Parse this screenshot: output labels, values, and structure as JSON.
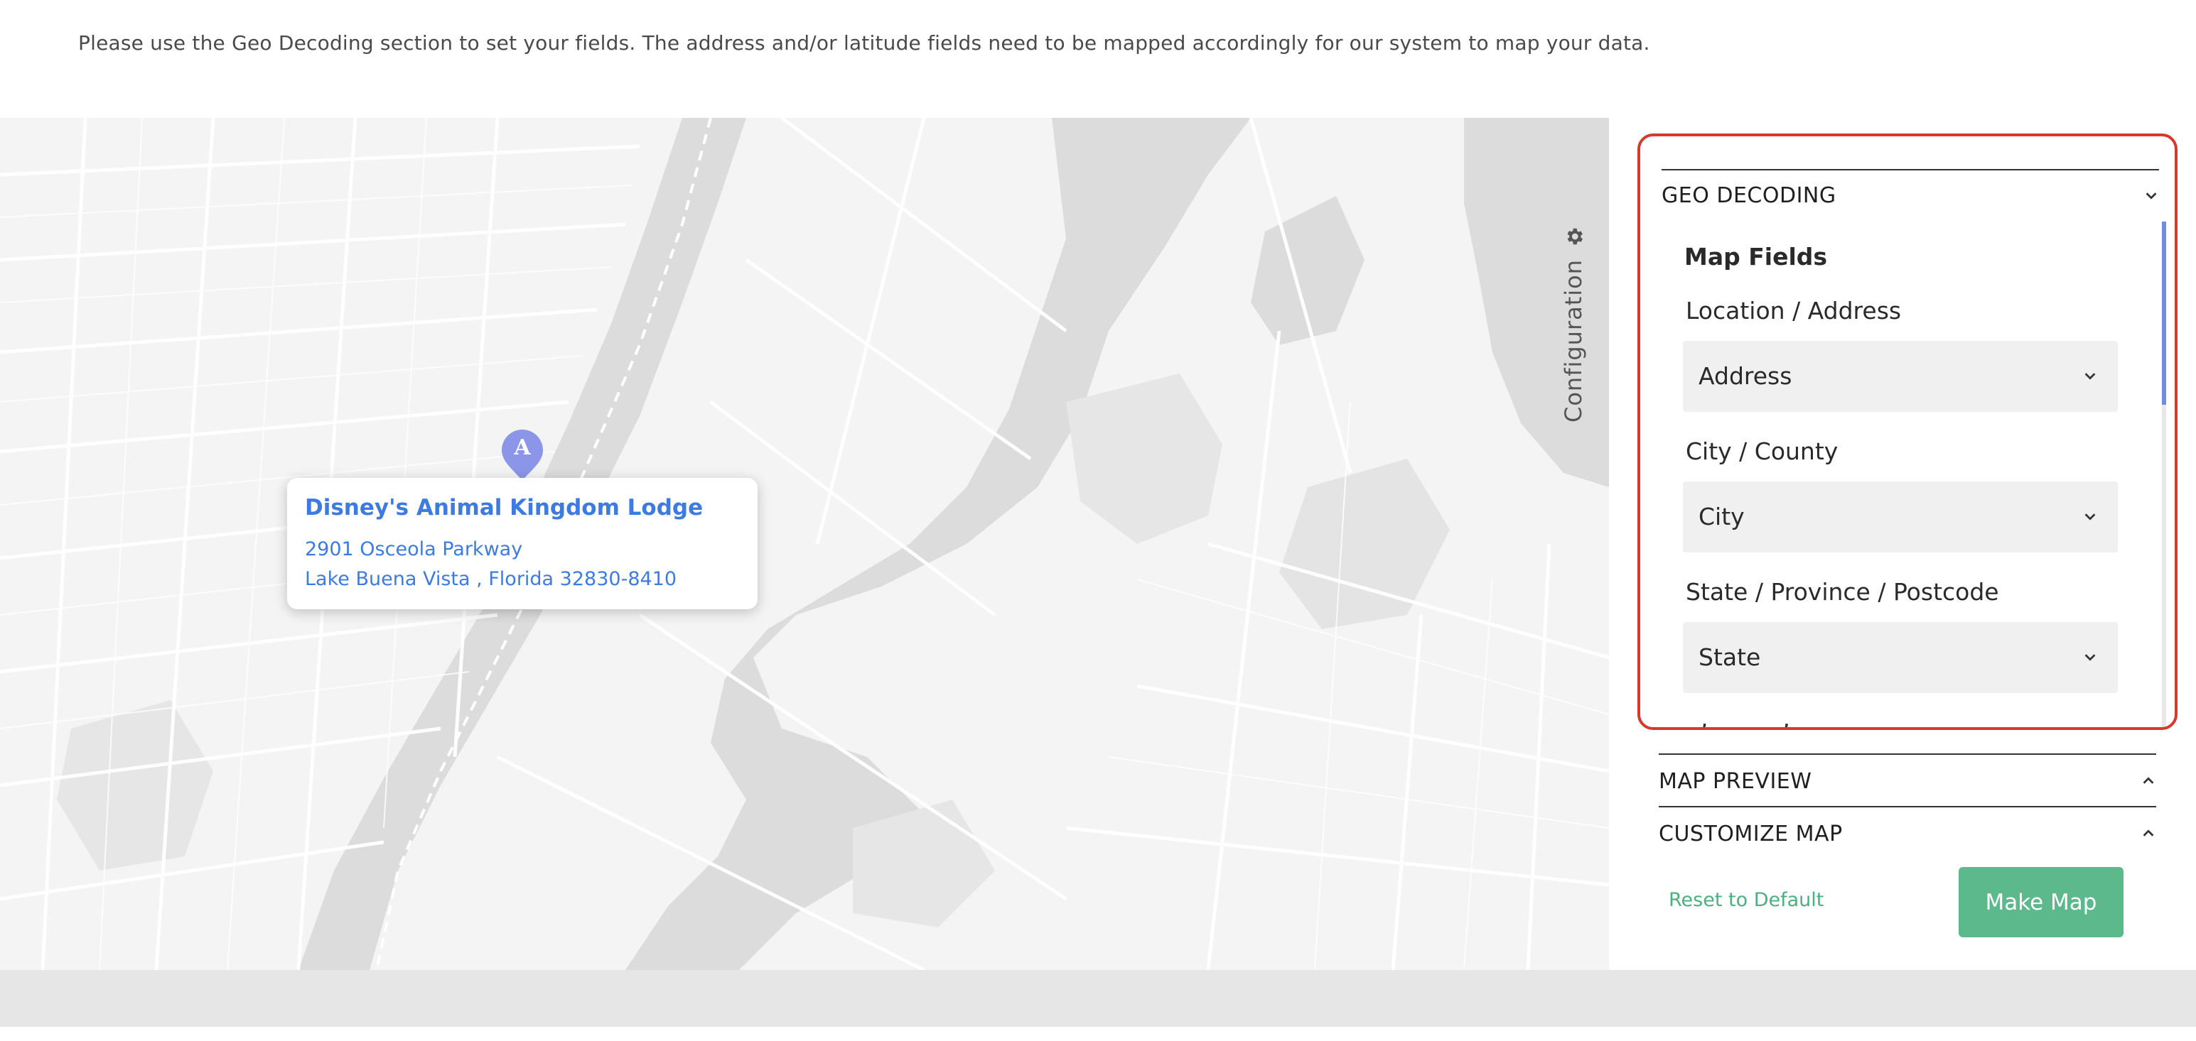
{
  "intro_text": "Please use the Geo Decoding section to set your fields. The address and/or latitude fields need to be mapped accordingly for our system to map your data.",
  "map": {
    "marker_letter": "A",
    "popup": {
      "title": "Disney's Animal Kingdom Lodge",
      "address_line1": "2901 Osceola Parkway",
      "address_line2": "Lake Buena Vista , Florida 32830-8410"
    }
  },
  "config_tab": {
    "label": "Configuration",
    "icon": "gear-icon"
  },
  "geo_decoding": {
    "title": "GEO DECODING",
    "section_title": "Map Fields",
    "fields": [
      {
        "label": "Location / Address",
        "value": "Address"
      },
      {
        "label": "City / County",
        "value": "City"
      },
      {
        "label": "State / Province / Postcode",
        "value": "State"
      }
    ],
    "cutoff_text": "  ,          ,"
  },
  "accordions": [
    {
      "label": "MAP PREVIEW"
    },
    {
      "label": "CUSTOMIZE MAP"
    }
  ],
  "actions": {
    "reset_label": "Reset to Default",
    "make_map_label": "Make Map"
  },
  "colors": {
    "accent_blue": "#3d7be0",
    "highlight_border": "#d53a2a",
    "button_green": "#5bb98c",
    "marker": "#8b96e8"
  }
}
